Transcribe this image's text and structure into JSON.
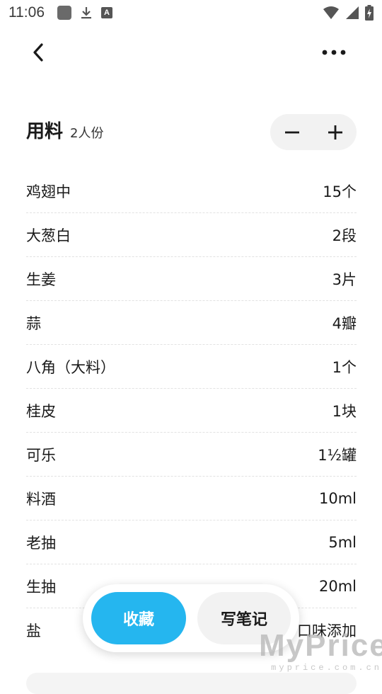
{
  "status_bar": {
    "time": "11:06"
  },
  "icons": {
    "back": "chevron-left-icon",
    "more": "more-horizontal-icon",
    "minus": "minus-icon",
    "plus": "plus-icon"
  },
  "ingredients": {
    "title": "用料",
    "servings": "2人份",
    "items": [
      {
        "name": "鸡翅中",
        "amount": "15个"
      },
      {
        "name": "大葱白",
        "amount": "2段"
      },
      {
        "name": "生姜",
        "amount": "3片"
      },
      {
        "name": "蒜",
        "amount": "4瓣"
      },
      {
        "name": "八角（大料）",
        "amount": "1个"
      },
      {
        "name": "桂皮",
        "amount": "1块"
      },
      {
        "name": "可乐",
        "amount": "1½罐"
      },
      {
        "name": "料酒",
        "amount": "10ml"
      },
      {
        "name": "老抽",
        "amount": "5ml"
      },
      {
        "name": "生抽",
        "amount": "20ml"
      },
      {
        "name": "盐",
        "amount": "口味添加"
      }
    ]
  },
  "actions": {
    "favorite_label": "收藏",
    "note_label": "写笔记"
  },
  "colors": {
    "accent": "#25b6ef",
    "stepper_bg": "#f2f2f2"
  },
  "watermark": {
    "main": "MyPrice",
    "sub": "myprice.com.cn"
  }
}
